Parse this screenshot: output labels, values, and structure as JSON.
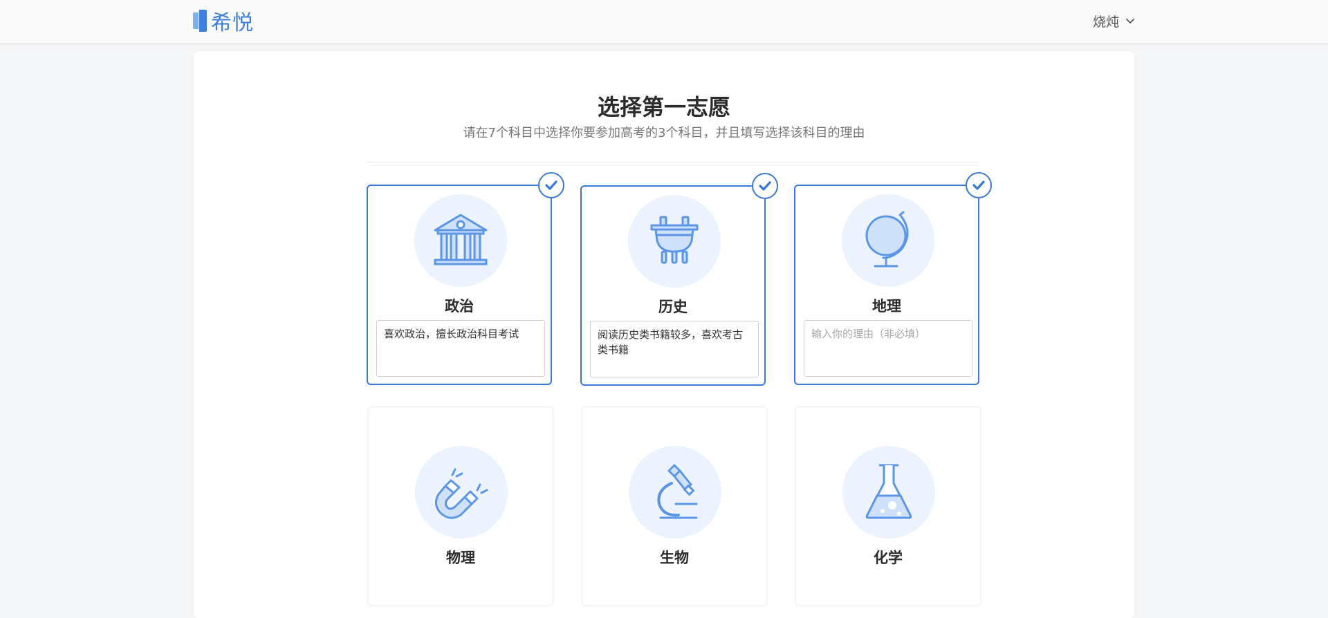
{
  "header": {
    "logo_text": "希悦",
    "user_name": "烧炖"
  },
  "main": {
    "title": "选择第一志愿",
    "subtitle": "请在7个科目中选择你要参加高考的3个科目，并且填写选择该科目的理由"
  },
  "subjects": [
    {
      "label": "政治",
      "selected": true,
      "icon": "government-building-icon",
      "reason": "喜欢政治，擅长政治科目考试",
      "placeholder": ""
    },
    {
      "label": "历史",
      "selected": true,
      "icon": "ancient-cauldron-icon",
      "reason": "阅读历史类书籍较多，喜欢考古类书籍",
      "placeholder": ""
    },
    {
      "label": "地理",
      "selected": true,
      "icon": "globe-icon",
      "reason": "",
      "placeholder": "输入你的理由（非必填）"
    },
    {
      "label": "物理",
      "selected": false,
      "icon": "magnet-icon"
    },
    {
      "label": "生物",
      "selected": false,
      "icon": "microscope-icon"
    },
    {
      "label": "化学",
      "selected": false,
      "icon": "flask-icon"
    }
  ],
  "colors": {
    "accent": "#3a78d6",
    "icon_bg": "#ecf3fe",
    "icon_stroke": "#5a95e6",
    "icon_fill": "#cfe0fb"
  }
}
